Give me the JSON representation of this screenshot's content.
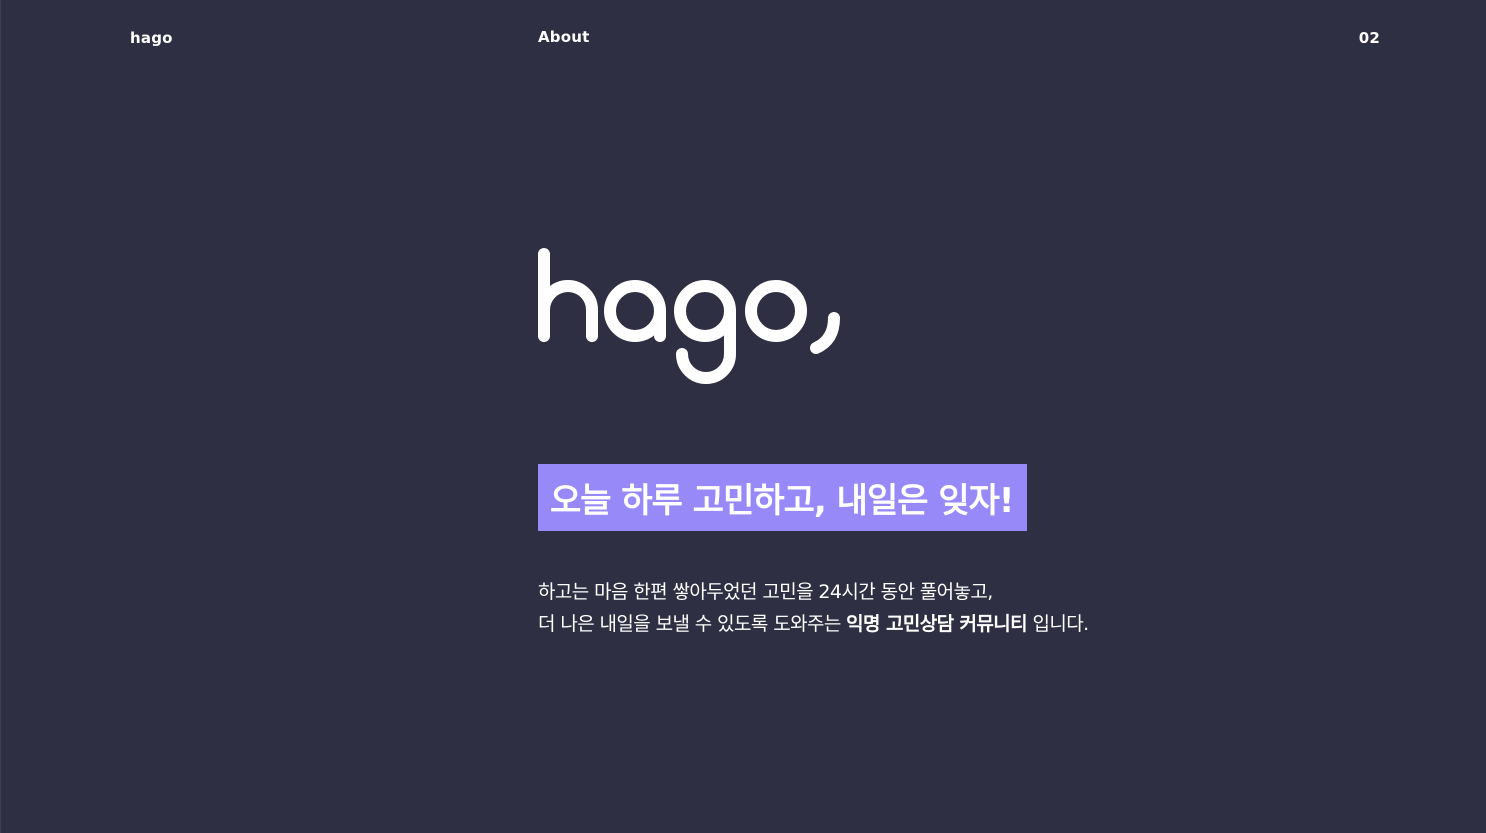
{
  "header": {
    "brand": "hago",
    "nav_about": "About",
    "page_number": "02"
  },
  "hero": {
    "logo_text": "hago,",
    "tagline": "오늘 하루 고민하고, 내일은 잊자!",
    "description": {
      "line1": "하고는 마음 한편 쌓아두었던 고민을 24시간 동안 풀어놓고,",
      "line2_before": "더 나은 내일을 보낼 수 있도록 도와주는 ",
      "line2_bold": "익명 고민상담 커뮤니티",
      "line2_after": " 입니다."
    }
  },
  "colors": {
    "background": "#2f2f43",
    "accent": "#9789f8",
    "text": "#ffffff"
  }
}
